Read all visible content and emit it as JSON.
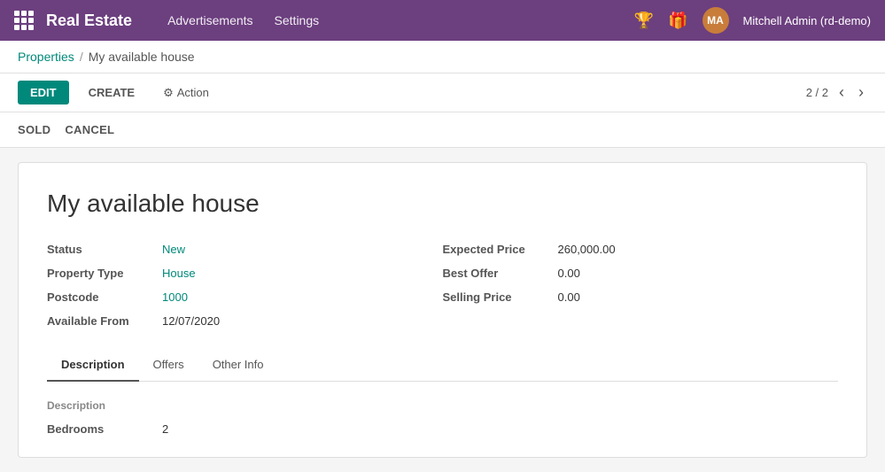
{
  "topnav": {
    "app_name": "Real Estate",
    "nav_links": [
      "Advertisements",
      "Settings"
    ],
    "user_label": "Mitchell Admin (rd-demo)"
  },
  "breadcrumb": {
    "parent": "Properties",
    "separator": "/",
    "current": "My available house"
  },
  "toolbar": {
    "edit_label": "EDIT",
    "create_label": "CREATE",
    "action_label": "Action",
    "pagination": "2 / 2"
  },
  "status_buttons": {
    "sold_label": "SOLD",
    "cancel_label": "CANCEL"
  },
  "record": {
    "title": "My available house",
    "fields_left": [
      {
        "label": "Status",
        "value": "New",
        "colored": true
      },
      {
        "label": "Property Type",
        "value": "House",
        "colored": true
      },
      {
        "label": "Postcode",
        "value": "1000",
        "colored": true
      },
      {
        "label": "Available From",
        "value": "12/07/2020",
        "colored": false
      }
    ],
    "fields_right": [
      {
        "label": "Expected Price",
        "value": "260,000.00",
        "colored": false
      },
      {
        "label": "Best Offer",
        "value": "0.00",
        "colored": false
      },
      {
        "label": "Selling Price",
        "value": "0.00",
        "colored": false
      }
    ]
  },
  "tabs": [
    {
      "id": "description",
      "label": "Description",
      "active": true
    },
    {
      "id": "offers",
      "label": "Offers",
      "active": false
    },
    {
      "id": "other-info",
      "label": "Other Info",
      "active": false
    }
  ],
  "tab_content": {
    "section_label": "Description",
    "fields": [
      {
        "label": "Bedrooms",
        "value": "2"
      }
    ]
  },
  "icons": {
    "grid": "grid",
    "trophy": "🏆",
    "gift": "🎁",
    "prev": "‹",
    "next": "›",
    "gear": "⚙"
  }
}
